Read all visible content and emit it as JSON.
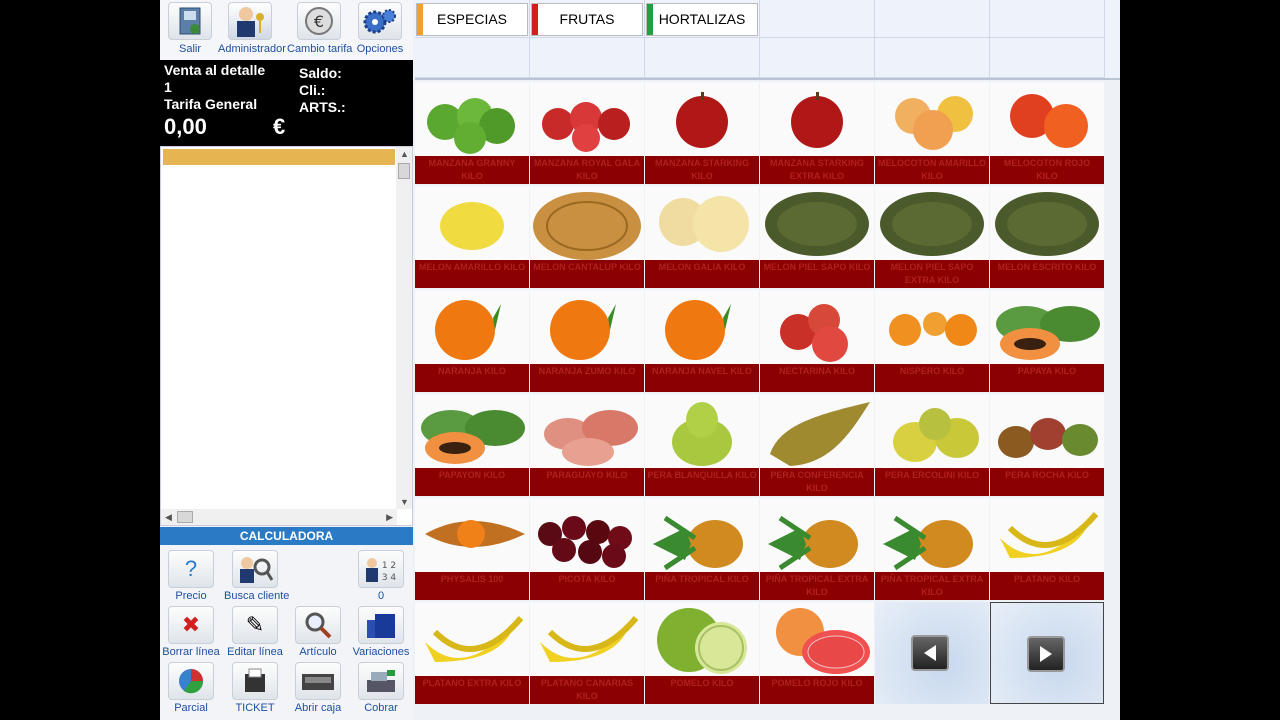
{
  "toolbar": {
    "salir": "Salir",
    "administrador": "Administrador",
    "cambio_tarifa": "Cambio tarifa",
    "opciones": "Opciones"
  },
  "info": {
    "venta": "Venta al detalle",
    "numero": "1",
    "tarifa": "Tarifa General",
    "total": "0,00",
    "currency": "€",
    "saldo": "Saldo:",
    "cli": "Cli.:",
    "arts": "ARTS.:"
  },
  "calculadora": "CALCULADORA",
  "actions": {
    "precio": "Precio",
    "busca_cliente": "Busca cliente",
    "counter": "0",
    "borrar_linea": "Borrar línea",
    "editar_linea": "Editar línea",
    "articulo": "Artículo",
    "variaciones": "Variaciones",
    "parcial": "Parcial",
    "ticket": "TICKET",
    "abrir_caja": "Abrir caja",
    "cobrar": "Cobrar"
  },
  "categories": [
    {
      "label": "ESPECIAS",
      "color": "#f0a030"
    },
    {
      "label": "FRUTAS",
      "color": "#d02020"
    },
    {
      "label": "HORTALIZAS",
      "color": "#20a040"
    }
  ],
  "products": [
    {
      "label": "MANZANA GRANNY KILO",
      "icon": "green-apple"
    },
    {
      "label": "MANZANA ROYAL GALA KILO",
      "icon": "red-apples"
    },
    {
      "label": "MANZANA STARKING KILO",
      "icon": "red-apple"
    },
    {
      "label": "MANZANA STARKING EXTRA KILO",
      "icon": "red-apple"
    },
    {
      "label": "MELOCOTON AMARILLO KILO",
      "icon": "peach"
    },
    {
      "label": "MELOCOTON ROJO KILO",
      "icon": "red-peach"
    },
    {
      "label": "MELON AMARILLO KILO",
      "icon": "yellow-melon"
    },
    {
      "label": "MELON CANTALUP KILO",
      "icon": "cantaloupe"
    },
    {
      "label": "MELON GALIA KILO",
      "icon": "galia-melon"
    },
    {
      "label": "MELON PIEL SAPO KILO",
      "icon": "green-melon"
    },
    {
      "label": "MELON PIEL SAPO EXTRA KILO",
      "icon": "green-melon"
    },
    {
      "label": "MELON ESCRITO KILO",
      "icon": "green-melon"
    },
    {
      "label": "NARANJA KILO",
      "icon": "orange"
    },
    {
      "label": "NARANJA ZUMO KILO",
      "icon": "orange"
    },
    {
      "label": "NARANJA NAVEL KILO",
      "icon": "orange"
    },
    {
      "label": "NECTARINA KILO",
      "icon": "nectarine"
    },
    {
      "label": "NISPERO KILO",
      "icon": "loquat"
    },
    {
      "label": "PAPAYA KILO",
      "icon": "papaya"
    },
    {
      "label": "PAPAYON KILO",
      "icon": "papaya"
    },
    {
      "label": "PARAGUAYO KILO",
      "icon": "flat-peach"
    },
    {
      "label": "PERA BLANQUILLA KILO",
      "icon": "pear"
    },
    {
      "label": "PERA CONFERENCIA KILO",
      "icon": "conference-pear"
    },
    {
      "label": "PERA ERCOLINI KILO",
      "icon": "pears"
    },
    {
      "label": "PERA ROCHA KILO",
      "icon": "red-pears"
    },
    {
      "label": "PHYSALIS 100",
      "icon": "physalis"
    },
    {
      "label": "PICOTA KILO",
      "icon": "cherries"
    },
    {
      "label": "PIÑA TROPICAL KILO",
      "icon": "pineapple"
    },
    {
      "label": "PIÑA TROPICAL EXTRA KILO",
      "icon": "pineapple"
    },
    {
      "label": "PIÑA TROPICAL EXTRA KILO",
      "icon": "pineapple"
    },
    {
      "label": "PLATANO KILO",
      "icon": "bananas"
    },
    {
      "label": "PLATANO EXTRA KILO",
      "icon": "bananas"
    },
    {
      "label": "PLATANO CANARIAS KILO",
      "icon": "bananas"
    },
    {
      "label": "POMELO KILO",
      "icon": "grapefruit"
    },
    {
      "label": "POMELO ROJO KILO",
      "icon": "red-grapefruit"
    }
  ]
}
